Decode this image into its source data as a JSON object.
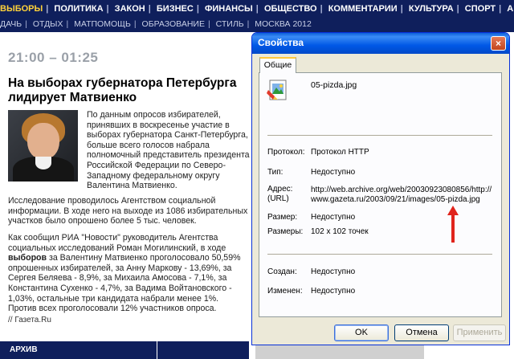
{
  "nav": {
    "row1": [
      "ВЫБОРЫ",
      "ПОЛИТИКА",
      "ЗАКОН",
      "БИЗНЕС",
      "ФИНАНСЫ",
      "ОБЩЕСТВО",
      "КОММЕНТАРИИ",
      "КУЛЬТУРА",
      "СПОРТ",
      "АВТО"
    ],
    "row2": [
      "ДАЧЬ",
      "ОТДЫХ",
      "МАТПОМОЩЬ",
      "ОБРАЗОВАНИЕ",
      "СТИЛЬ",
      "МОСКВА 2012"
    ]
  },
  "article": {
    "timeslot": "21:00 – 01:25",
    "headline": "На выборах губернатора Петербурга лидирует Матвиенко",
    "lead": "По данным опросов избирателей, принявших в воскресенье участие в выборах губернатора Санкт-Петербурга, больше всего голосов набрала полномочный представитель президента Российской Федерации по Северо-Западному федеральному округу Валентина Матвиенко.",
    "para1": "Исследование проводилось Агентством социальной информации. В ходе него на выходе из 1086 избирательных участков было опрошено более 5 тыс. человек.",
    "para2_a": "Как сообщил РИА \"Новости\" руководитель Агентства социальных исследований Роман Могилинский, в ходе ",
    "para2_bold": "выборов",
    "para2_b": " за Валентину Матвиенко проголосовало 50,59% опрошенных избирателей, за Анну Маркову - 13,69%, за Сергея Беляева - 8,9%, за Михаила Амосова - 7,1%, за Константина Сухенко - 4,7%, за Вадима Войтановского - 1,03%, остальные три кандидата набрали менее 1%. Против всех проголосовали 12% участников опроса.",
    "source": "// Газета.Ru",
    "archive": "АРХИВ"
  },
  "dialog": {
    "title": "Свойства",
    "close": "×",
    "tab": "Общие",
    "filename": "05-pizda.jpg",
    "rows": {
      "protocol_label": "Протокол:",
      "protocol_value": "Протокол HTTP",
      "type_label": "Тип:",
      "type_value": "Недоступно",
      "address_label": "Адрес:\n(URL)",
      "address_value": "http://web.archive.org/web/20030923080856/http://www.gazeta.ru/2003/09/21/images/05-pizda.jpg",
      "size_label": "Размер:",
      "size_value": "Недоступно",
      "dims_label": "Размеры:",
      "dims_value": "102  x  102 точек",
      "created_label": "Создан:",
      "created_value": "Недоступно",
      "modified_label": "Изменен:",
      "modified_value": "Недоступно"
    },
    "buttons": {
      "ok": "OK",
      "cancel": "Отмена",
      "apply": "Применить"
    }
  },
  "icons": {
    "file": "image-file-icon",
    "arrow": "red-arrow-up-icon"
  },
  "colors": {
    "nav_bg": "#0f1f5c",
    "nav_active": "#ffd23a",
    "title_bar": "#0058e6",
    "dialog_bg": "#ece9d8",
    "arrow": "#e0241c"
  }
}
